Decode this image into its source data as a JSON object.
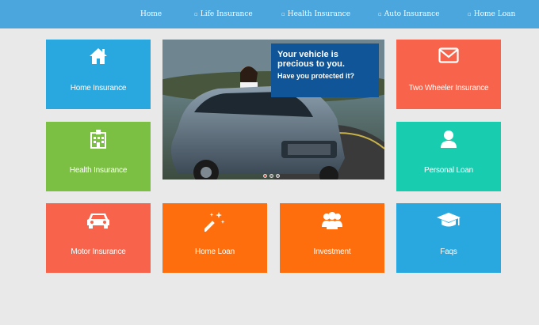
{
  "nav": {
    "items": [
      {
        "label": "Home",
        "bullet": false
      },
      {
        "label": "Life Insurance",
        "bullet": true
      },
      {
        "label": "Health Insurance",
        "bullet": true
      },
      {
        "label": "Auto Insurance",
        "bullet": true
      },
      {
        "label": "Home Loan",
        "bullet": true
      }
    ],
    "bullet_glyph": "▫"
  },
  "slider": {
    "caption_line1": "Your vehicle is precious to you.",
    "caption_line2": "Have you protected it?",
    "active_dot": 1,
    "dot_count": 3
  },
  "tiles": [
    {
      "label": "Home Insurance",
      "icon": "home-icon",
      "color": "#29a8e0"
    },
    {
      "label": "Two Wheeler Insurance",
      "icon": "envelope-icon",
      "color": "#f7644b"
    },
    {
      "label": "Health Insurance",
      "icon": "hospital-icon",
      "color": "#7bc043"
    },
    {
      "label": "Personal Loan",
      "icon": "user-icon",
      "color": "#18ccb0"
    },
    {
      "label": "Motor Insurance",
      "icon": "car-icon",
      "color": "#f7644b"
    },
    {
      "label": "Home Loan",
      "icon": "magic-wand-icon",
      "color": "#ff6e0c"
    },
    {
      "label": "Investment",
      "icon": "group-icon",
      "color": "#ff6e0c"
    },
    {
      "label": "Faqs",
      "icon": "graduation-cap-icon",
      "color": "#29a8e0"
    }
  ]
}
